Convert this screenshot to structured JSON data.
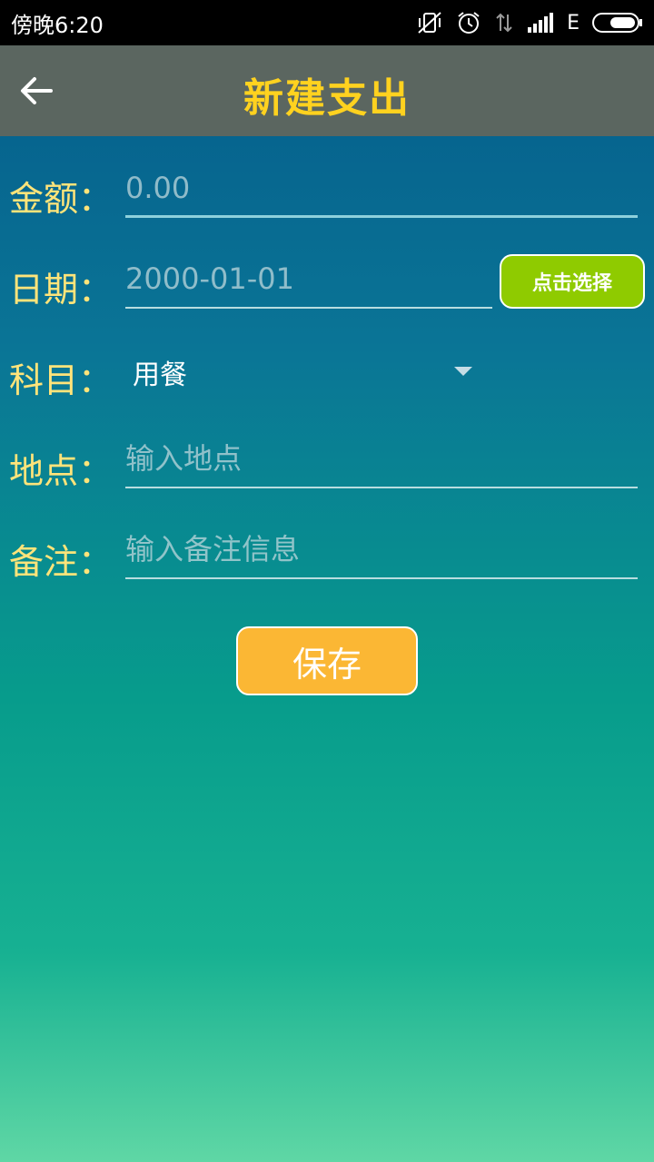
{
  "status_bar": {
    "time": "傍晚6:20",
    "network": "E",
    "icons": [
      "vibrate-off-icon",
      "alarm-icon",
      "data-transfer-icon",
      "signal-icon",
      "battery-icon"
    ]
  },
  "app_bar": {
    "title": "新建支出",
    "back_icon": "back-arrow-icon"
  },
  "form": {
    "amount": {
      "label": "金额：",
      "value": "",
      "placeholder": "0.00"
    },
    "date": {
      "label": "日期：",
      "value": "",
      "placeholder": "2000-01-01",
      "pick_button": "点击选择"
    },
    "category": {
      "label": "科目：",
      "selected": "用餐"
    },
    "location": {
      "label": "地点：",
      "value": "",
      "placeholder": "输入地点"
    },
    "note": {
      "label": "备注：",
      "value": "",
      "placeholder": "输入备注信息"
    }
  },
  "save_button": "保存",
  "colors": {
    "title": "#ffd21f",
    "label": "#ffe47a",
    "app_bar_bg": "#5b6660",
    "pick_button_bg": "#8fcb00",
    "save_button_bg": "#fbb734"
  }
}
